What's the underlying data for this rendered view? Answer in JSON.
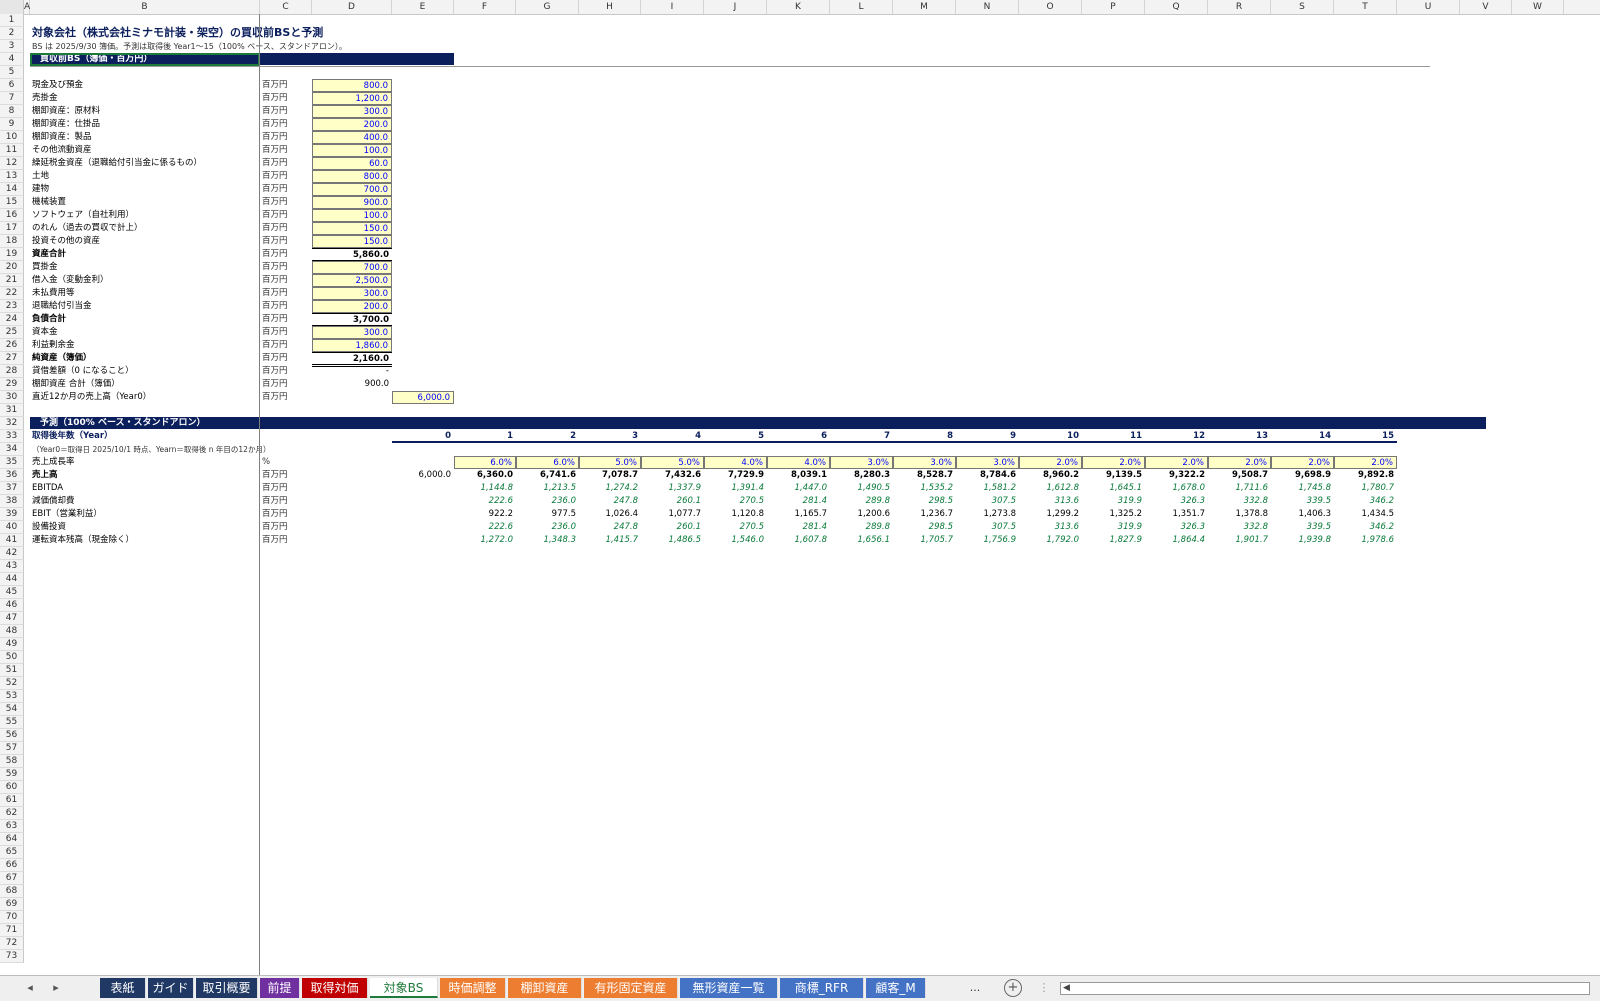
{
  "columns": [
    "A",
    "B",
    "C",
    "D",
    "E",
    "F",
    "G",
    "H",
    "I",
    "J",
    "K",
    "L",
    "M",
    "N",
    "O",
    "P",
    "Q",
    "R",
    "S",
    "T",
    "U",
    "V",
    "W"
  ],
  "sheet_title": "対象会社（株式会社ミナモ計装・架空）の買収前BSと予測",
  "sheet_note": "BS は 2025/9/30 簿価。予測は取得後 Year1〜15（100% ベース、スタンドアロン）。",
  "bs_header": "買収前BS（簿価・百万円）",
  "unit_label": "百万円",
  "bs_rows": [
    {
      "row": 6,
      "label": "現金及び預金",
      "value": "800.0",
      "type": "input"
    },
    {
      "row": 7,
      "label": "売掛金",
      "value": "1,200.0",
      "type": "input"
    },
    {
      "row": 8,
      "label": "棚卸資産：原材料",
      "value": "300.0",
      "type": "input"
    },
    {
      "row": 9,
      "label": "棚卸資産：仕掛品",
      "value": "200.0",
      "type": "input"
    },
    {
      "row": 10,
      "label": "棚卸資産：製品",
      "value": "400.0",
      "type": "input"
    },
    {
      "row": 11,
      "label": "その他流動資産",
      "value": "100.0",
      "type": "input"
    },
    {
      "row": 12,
      "label": "繰延税金資産（退職給付引当金に係るもの）",
      "value": "60.0",
      "type": "input"
    },
    {
      "row": 13,
      "label": "土地",
      "value": "800.0",
      "type": "input"
    },
    {
      "row": 14,
      "label": "建物",
      "value": "700.0",
      "type": "input"
    },
    {
      "row": 15,
      "label": "機械装置",
      "value": "900.0",
      "type": "input"
    },
    {
      "row": 16,
      "label": "ソフトウェア（自社利用）",
      "value": "100.0",
      "type": "input"
    },
    {
      "row": 17,
      "label": "のれん（過去の買収で計上）",
      "value": "150.0",
      "type": "input"
    },
    {
      "row": 18,
      "label": "投資その他の資産",
      "value": "150.0",
      "type": "input"
    },
    {
      "row": 19,
      "label": "資産合計",
      "value": "5,860.0",
      "type": "total"
    },
    {
      "row": 20,
      "label": "買掛金",
      "value": "700.0",
      "type": "input"
    },
    {
      "row": 21,
      "label": "借入金（変動金利）",
      "value": "2,500.0",
      "type": "input"
    },
    {
      "row": 22,
      "label": "未払費用等",
      "value": "300.0",
      "type": "input"
    },
    {
      "row": 23,
      "label": "退職給付引当金",
      "value": "200.0",
      "type": "input"
    },
    {
      "row": 24,
      "label": "負債合計",
      "value": "3,700.0",
      "type": "total"
    },
    {
      "row": 25,
      "label": "資本金",
      "value": "300.0",
      "type": "input"
    },
    {
      "row": 26,
      "label": "利益剰余金",
      "value": "1,860.0",
      "type": "input"
    },
    {
      "row": 27,
      "label": "純資産（簿価）",
      "value": "2,160.0",
      "type": "total"
    },
    {
      "row": 28,
      "label": "貸借差額（0 になること）",
      "value": "-",
      "type": "plain"
    },
    {
      "row": 29,
      "label": "棚卸資産 合計（簿価）",
      "value": "900.0",
      "type": "plain"
    },
    {
      "row": 30,
      "label": "直近12か月の売上高（Year0）",
      "value": "6,000.0",
      "type": "input_e"
    }
  ],
  "forecast_header": "予測（100% ベース・スタンドアロン）",
  "year_label": "取得後年数（Year）",
  "year_note": "（Year0＝取得日 2025/10/1 時点、Yearn＝取得後 n 年目の12か月）",
  "years": [
    "0",
    "1",
    "2",
    "3",
    "4",
    "5",
    "6",
    "7",
    "8",
    "9",
    "10",
    "11",
    "12",
    "13",
    "14",
    "15"
  ],
  "forecast_rows": [
    {
      "row": 35,
      "label": "売上成長率",
      "unit": "%",
      "style": "input",
      "values": [
        "",
        "6.0%",
        "6.0%",
        "5.0%",
        "5.0%",
        "4.0%",
        "4.0%",
        "3.0%",
        "3.0%",
        "3.0%",
        "2.0%",
        "2.0%",
        "2.0%",
        "2.0%",
        "2.0%",
        "2.0%"
      ]
    },
    {
      "row": 36,
      "label": "売上高",
      "unit": "百万円",
      "style": "bold",
      "values": [
        "6,000.0",
        "6,360.0",
        "6,741.6",
        "7,078.7",
        "7,432.6",
        "7,729.9",
        "8,039.1",
        "8,280.3",
        "8,528.7",
        "8,784.6",
        "8,960.2",
        "9,139.5",
        "9,322.2",
        "9,508.7",
        "9,698.9",
        "9,892.8"
      ]
    },
    {
      "row": 37,
      "label": "EBITDA",
      "unit": "百万円",
      "style": "green",
      "values": [
        "",
        "1,144.8",
        "1,213.5",
        "1,274.2",
        "1,337.9",
        "1,391.4",
        "1,447.0",
        "1,490.5",
        "1,535.2",
        "1,581.2",
        "1,612.8",
        "1,645.1",
        "1,678.0",
        "1,711.6",
        "1,745.8",
        "1,780.7"
      ]
    },
    {
      "row": 38,
      "label": "減価償却費",
      "unit": "百万円",
      "style": "green",
      "values": [
        "",
        "222.6",
        "236.0",
        "247.8",
        "260.1",
        "270.5",
        "281.4",
        "289.8",
        "298.5",
        "307.5",
        "313.6",
        "319.9",
        "326.3",
        "332.8",
        "339.5",
        "346.2"
      ]
    },
    {
      "row": 39,
      "label": "EBIT（営業利益）",
      "unit": "百万円",
      "style": "plain",
      "values": [
        "",
        "922.2",
        "977.5",
        "1,026.4",
        "1,077.7",
        "1,120.8",
        "1,165.7",
        "1,200.6",
        "1,236.7",
        "1,273.8",
        "1,299.2",
        "1,325.2",
        "1,351.7",
        "1,378.8",
        "1,406.3",
        "1,434.5"
      ]
    },
    {
      "row": 40,
      "label": "設備投資",
      "unit": "百万円",
      "style": "green",
      "values": [
        "",
        "222.6",
        "236.0",
        "247.8",
        "260.1",
        "270.5",
        "281.4",
        "289.8",
        "298.5",
        "307.5",
        "313.6",
        "319.9",
        "326.3",
        "332.8",
        "339.5",
        "346.2"
      ]
    },
    {
      "row": 41,
      "label": "運転資本残高（現金除く）",
      "unit": "百万円",
      "style": "green",
      "values": [
        "",
        "1,272.0",
        "1,348.3",
        "1,415.7",
        "1,486.5",
        "1,546.0",
        "1,607.8",
        "1,656.1",
        "1,705.7",
        "1,756.9",
        "1,792.0",
        "1,827.9",
        "1,864.4",
        "1,901.7",
        "1,939.8",
        "1,978.6"
      ]
    }
  ],
  "tabs": [
    {
      "label": "表紙",
      "color": "#1f3864"
    },
    {
      "label": "ガイド",
      "color": "#1f3864"
    },
    {
      "label": "取引概要",
      "color": "#1f3864"
    },
    {
      "label": "前提",
      "color": "#7030a0"
    },
    {
      "label": "取得対価",
      "color": "#c00000"
    },
    {
      "label": "対象BS",
      "color": "#ffffff",
      "active": true
    },
    {
      "label": "時価調整",
      "color": "#ed7d31"
    },
    {
      "label": "棚卸資産",
      "color": "#ed7d31"
    },
    {
      "label": "有形固定資産",
      "color": "#ed7d31"
    },
    {
      "label": "無形資産一覧",
      "color": "#4472c4"
    },
    {
      "label": "商標_RFR",
      "color": "#4472c4"
    },
    {
      "label": "顧客_M",
      "color": "#4472c4"
    }
  ],
  "tab_overflow": "...",
  "add_sheet_icon": "plus-circle-icon"
}
